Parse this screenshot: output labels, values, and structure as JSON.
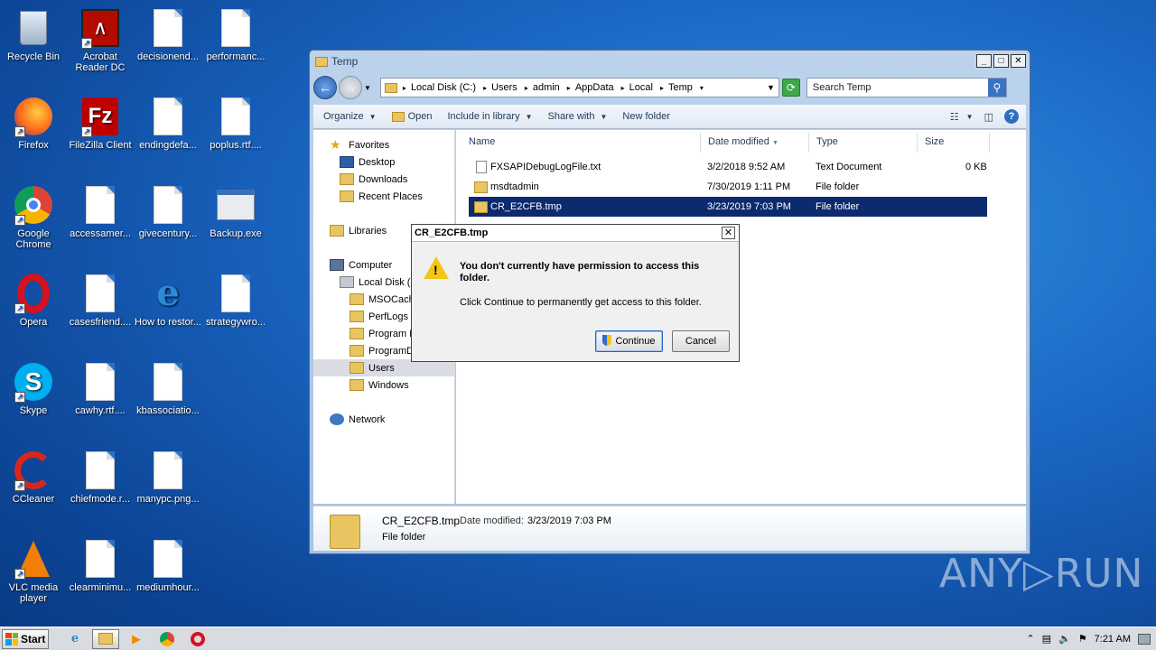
{
  "desktop": {
    "icons": [
      {
        "label": "Recycle Bin"
      },
      {
        "label": "Acrobat Reader DC"
      },
      {
        "label": "decisionend..."
      },
      {
        "label": "performanc..."
      },
      {
        "label": "Firefox"
      },
      {
        "label": "FileZilla Client"
      },
      {
        "label": "endingdefa..."
      },
      {
        "label": "poplus.rtf...."
      },
      {
        "label": "Google Chrome"
      },
      {
        "label": "accessamer..."
      },
      {
        "label": "givecentury..."
      },
      {
        "label": "Backup.exe"
      },
      {
        "label": "Opera"
      },
      {
        "label": "casesfriend...."
      },
      {
        "label": "How to restor..."
      },
      {
        "label": "strategywro..."
      },
      {
        "label": "Skype"
      },
      {
        "label": "cawhy.rtf...."
      },
      {
        "label": "kbassociatio..."
      },
      {
        "label": "CCleaner"
      },
      {
        "label": "chiefmode.r..."
      },
      {
        "label": "manypc.png..."
      },
      {
        "label": "VLC media player"
      },
      {
        "label": "clearminimu..."
      },
      {
        "label": "mediumhour..."
      }
    ]
  },
  "explorer": {
    "title": "Temp",
    "breadcrumb": [
      "Local Disk (C:)",
      "Users",
      "admin",
      "AppData",
      "Local",
      "Temp"
    ],
    "search_placeholder": "Search Temp",
    "toolbar": {
      "organize": "Organize",
      "open": "Open",
      "include": "Include in library",
      "share": "Share with",
      "new_folder": "New folder"
    },
    "nav": {
      "favorites": "Favorites",
      "desktop": "Desktop",
      "downloads": "Downloads",
      "recent": "Recent Places",
      "libraries": "Libraries",
      "computer": "Computer",
      "local_disk": "Local Disk (C",
      "folders": [
        "MSOCache",
        "PerfLogs",
        "Program F",
        "ProgramD",
        "Users",
        "Windows"
      ],
      "network": "Network"
    },
    "columns": {
      "name": "Name",
      "date": "Date modified",
      "type": "Type",
      "size": "Size"
    },
    "files": [
      {
        "name": "FXSAPIDebugLogFile.txt",
        "date": "3/2/2018 9:52 AM",
        "type": "Text Document",
        "size": "0 KB"
      },
      {
        "name": "msdtadmin",
        "date": "7/30/2019 1:11 PM",
        "type": "File folder",
        "size": ""
      },
      {
        "name": "CR_E2CFB.tmp",
        "date": "3/23/2019 7:03 PM",
        "type": "File folder",
        "size": ""
      }
    ],
    "details": {
      "name": "CR_E2CFB.tmp",
      "date_label": "Date modified:",
      "date": "3/23/2019 7:03 PM",
      "type": "File folder"
    }
  },
  "dialog": {
    "title": "CR_E2CFB.tmp",
    "heading": "You don't currently have permission to access this folder.",
    "body": "Click Continue to permanently get access to this folder.",
    "continue": "Continue",
    "cancel": "Cancel"
  },
  "taskbar": {
    "start": "Start",
    "clock": "7:21 AM"
  },
  "watermark": "ANY▷RUN"
}
